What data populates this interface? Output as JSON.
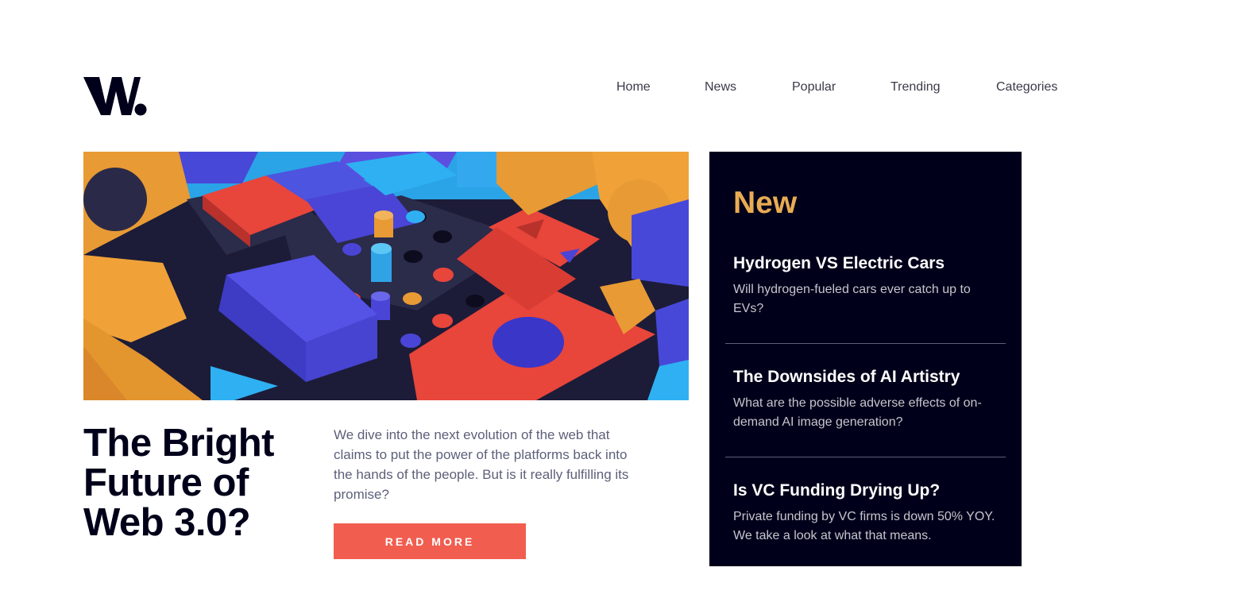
{
  "brand": {
    "logo_text": "W."
  },
  "nav": {
    "items": [
      {
        "label": "Home"
      },
      {
        "label": "News"
      },
      {
        "label": "Popular"
      },
      {
        "label": "Trending"
      },
      {
        "label": "Categories"
      }
    ]
  },
  "hero": {
    "title": "The Bright Future of Web 3.0?",
    "description": "We dive into the next evolution of the web that claims to put the power of the platforms back into the hands of the people. But is it really fulfilling its promise?",
    "cta_label": "READ MORE"
  },
  "new_panel": {
    "title": "New",
    "items": [
      {
        "title": "Hydrogen VS Electric Cars",
        "summary": "Will hydrogen-fueled cars ever catch up to EVs?"
      },
      {
        "title": "The Downsides of AI Artistry",
        "summary": "What are the possible adverse effects of on-demand AI image generation?"
      },
      {
        "title": "Is VC Funding Drying Up?",
        "summary": "Private funding by VC firms is down 50% YOY. We take a look at what that means."
      }
    ]
  },
  "colors": {
    "dark_navy": "#00001a",
    "soft_orange": "#e9ab53",
    "soft_red": "#f15e50",
    "grayish_blue": "#5d5f79",
    "off_white": "#c5c6ce"
  }
}
